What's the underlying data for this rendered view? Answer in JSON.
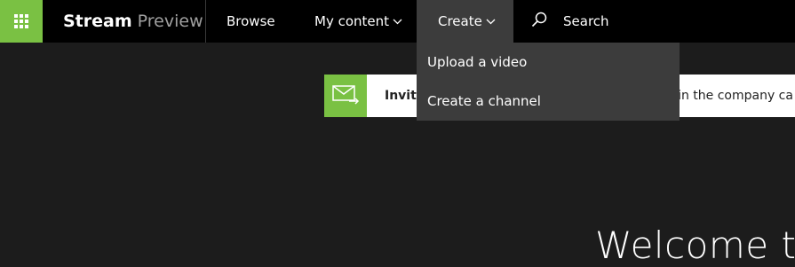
{
  "header": {
    "brand_name": "Stream",
    "brand_sub": "Preview",
    "nav": {
      "browse": "Browse",
      "my_content": "My content",
      "create": "Create"
    },
    "search_label": "Search"
  },
  "create_menu": {
    "items": [
      "Upload a video",
      "Create a channel"
    ]
  },
  "invite_banner": {
    "bold_fragment": "Invite",
    "tail_fragment": "e in the company ca"
  },
  "main": {
    "welcome_fragment": "Welcome to"
  },
  "colors": {
    "accent": "#7ac143",
    "topbar": "#000000",
    "background": "#1c1c1c",
    "menu": "#3c3c3c"
  }
}
